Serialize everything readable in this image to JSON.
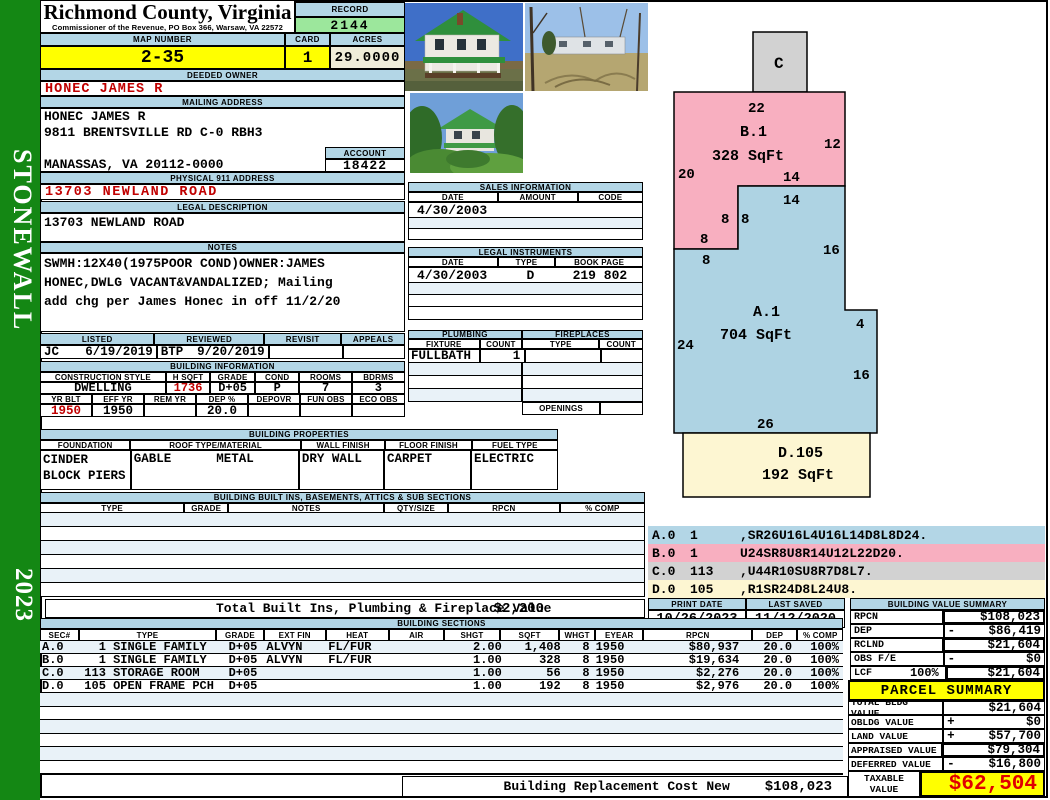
{
  "sidebar": {
    "district": "STONEWALL",
    "year": "2023"
  },
  "header": {
    "county": "Richmond County, Virginia",
    "commissioner": "Commissioner of the Revenue, PO Box 366, Warsaw, VA 22572",
    "record_label": "RECORD",
    "record_value": "2144",
    "map_label": "MAP NUMBER",
    "map_value": "2-35",
    "card_label": "CARD",
    "card_value": "1",
    "acres_label": "ACRES",
    "acres_value": "29.0000"
  },
  "owner": {
    "deeded_label": "DEEDED OWNER",
    "deeded": "HONEC JAMES R",
    "mailing_label": "MAILING ADDRESS",
    "mailing_line1": "HONEC JAMES R",
    "mailing_line2": "9811 BRENTSVILLE RD C-0 RBH3",
    "mailing_line3": "MANASSAS, VA 20112-0000",
    "account_label": "ACCOUNT",
    "account": "18422",
    "physical_label": "PHYSICAL 911 ADDRESS",
    "physical": "13703 NEWLAND ROAD",
    "legal_label": "LEGAL DESCRIPTION",
    "legal": "13703 NEWLAND ROAD"
  },
  "notes": {
    "label": "NOTES",
    "line1": "SWMH:12X40(1975POOR COND)OWNER:JAMES",
    "line2": "HONEC,DWLG VACANT&VANDALIZED; Mailing",
    "line3": "add chg per James Honec in off 11/2/20"
  },
  "review": {
    "listed_label": "LISTED",
    "reviewed_label": "REVIEWED",
    "revisit_label": "REVISIT",
    "appeals_label": "APPEALS",
    "listed_by": "JC",
    "listed_date": "6/19/2019",
    "reviewed_by": "BTP",
    "reviewed_date": "9/20/2019",
    "revisit": "",
    "appeals": ""
  },
  "building_info": {
    "label": "BUILDING INFORMATION",
    "h1": [
      "CONSTRUCTION STYLE",
      "H SQFT",
      "GRADE",
      "COND",
      "ROOMS",
      "BDRMS"
    ],
    "style": "DWELLING",
    "hsqft": "1736",
    "grade": "D+05",
    "cond": "P",
    "rooms": "7",
    "bdrms": "3",
    "h2": [
      "YR BLT",
      "EFF YR",
      "REM YR",
      "DEP %",
      "DEPOVR",
      "FUN OBS",
      "ECO OBS"
    ],
    "yr_blt": "1950",
    "eff_yr": "1950",
    "rem_yr": "",
    "dep_pct": "20.0",
    "depovr": "",
    "fun_obs": "",
    "eco_obs": ""
  },
  "properties": {
    "label": "BUILDING PROPERTIES",
    "headers": [
      "FOUNDATION",
      "ROOF TYPE/MATERIAL",
      "WALL FINISH",
      "FLOOR FINISH",
      "FUEL TYPE"
    ],
    "foundation": "CINDER BLOCK PIERS",
    "roof_type": "GABLE",
    "roof_material": "METAL",
    "wall_finish": "DRY WALL",
    "floor_finish": "CARPET",
    "fuel_type": "ELECTRIC"
  },
  "built_ins": {
    "label": "BUILDING BUILT INS, BASEMENTS, ATTICS & SUB SECTIONS",
    "headers": [
      "TYPE",
      "GRADE",
      "NOTES",
      "QTY/SIZE",
      "RPCN",
      "% COMP"
    ],
    "total_label": "Total Built Ins, Plumbing & Fireplace Value",
    "total_value": "$2,200"
  },
  "sales": {
    "label": "SALES INFORMATION",
    "headers": [
      "DATE",
      "AMOUNT",
      "CODE"
    ],
    "rows": [
      {
        "date": "4/30/2003",
        "amount": "",
        "code": ""
      }
    ]
  },
  "instruments": {
    "label": "LEGAL INSTRUMENTS",
    "headers": [
      "DATE",
      "TYPE",
      "BOOK PAGE"
    ],
    "rows": [
      {
        "date": "4/30/2003",
        "type": "D",
        "book_page": "219 802"
      }
    ]
  },
  "plumbing": {
    "label": "PLUMBING",
    "headers": [
      "FIXTURE",
      "COUNT"
    ],
    "rows": [
      {
        "fixture": "FULLBATH",
        "count": "1"
      }
    ]
  },
  "fireplaces": {
    "label": "FIREPLACES",
    "headers": [
      "TYPE",
      "COUNT"
    ],
    "openings_label": "OPENINGS"
  },
  "diagram": {
    "c_label": "C",
    "b_label": "B.1",
    "b_sqft": "328 SqFt",
    "a_label": "A.1",
    "a_sqft": "704 SqFt",
    "d_label": "D.105",
    "d_sqft": "192 SqFt",
    "dims": {
      "b_top": "22",
      "b_right": "12",
      "b_left": "20",
      "b_inner14": "14",
      "a_top14": "14",
      "step8a": "8",
      "step8b": "8",
      "step8c": "8",
      "step8d": "8",
      "a_right16u": "16",
      "a_left24": "24",
      "a_notch4": "4",
      "a_right16l": "16",
      "a_bottom26": "26"
    }
  },
  "vectors": [
    {
      "sec": "A.0",
      "qty": "1",
      "path": ",SR26U16L4U16L14D8L8D24."
    },
    {
      "sec": "B.0",
      "qty": "1",
      "path": "U24SR8U8R14U12L22D20."
    },
    {
      "sec": "C.0",
      "qty": "113",
      "path": ",U44R10SU8R7D8L7."
    },
    {
      "sec": "D.0",
      "qty": "105",
      "path": ",R1SR24D8L24U8."
    }
  ],
  "print_info": {
    "print_label": "PRINT DATE",
    "print_date": "10/26/2023",
    "saved_label": "LAST SAVED",
    "last_saved": "11/12/2020"
  },
  "value_summary": {
    "label": "BUILDING VALUE SUMMARY",
    "rows": [
      {
        "label": "RPCN",
        "mid": "",
        "op": "",
        "value": "$108,023"
      },
      {
        "label": "DEP",
        "mid": "",
        "op": "-",
        "value": "$86,419"
      },
      {
        "label": "RCLND",
        "mid": "",
        "op": "",
        "value": "$21,604"
      },
      {
        "label": "OBS F/E",
        "mid": "",
        "op": "-",
        "value": "$0"
      },
      {
        "label": "LCF",
        "mid": "100%",
        "op": "",
        "value": "$21,604"
      }
    ]
  },
  "building_sections": {
    "label": "BUILDING SECTIONS",
    "headers": [
      "SEC#",
      "TYPE",
      "GRADE",
      "EXT FIN",
      "HEAT",
      "AIR",
      "SHGT",
      "SQFT",
      "WHGT",
      "EYEAR",
      "RPCN",
      "DEP",
      "% COMP"
    ],
    "rows": [
      {
        "sec": "A.0",
        "type_code": "1",
        "type_name": "SINGLE FAMILY",
        "grade": "D+05",
        "ext_fin": "ALVYN",
        "heat": "FL/FUR",
        "air": "",
        "shgt": "2.00",
        "sqft": "1,408",
        "whgt": "8",
        "eyear": "1950",
        "rpcn": "$80,937",
        "dep": "20.0",
        "comp": "100%"
      },
      {
        "sec": "B.0",
        "type_code": "1",
        "type_name": "SINGLE FAMILY",
        "grade": "D+05",
        "ext_fin": "ALVYN",
        "heat": "FL/FUR",
        "air": "",
        "shgt": "1.00",
        "sqft": "328",
        "whgt": "8",
        "eyear": "1950",
        "rpcn": "$19,634",
        "dep": "20.0",
        "comp": "100%"
      },
      {
        "sec": "C.0",
        "type_code": "113",
        "type_name": "STORAGE ROOM",
        "grade": "D+05",
        "ext_fin": "",
        "heat": "",
        "air": "",
        "shgt": "1.00",
        "sqft": "56",
        "whgt": "8",
        "eyear": "1950",
        "rpcn": "$2,276",
        "dep": "20.0",
        "comp": "100%"
      },
      {
        "sec": "D.0",
        "type_code": "105",
        "type_name": "OPEN FRAME PCH",
        "grade": "D+05",
        "ext_fin": "",
        "heat": "",
        "air": "",
        "shgt": "1.00",
        "sqft": "192",
        "whgt": "8",
        "eyear": "1950",
        "rpcn": "$2,976",
        "dep": "20.0",
        "comp": "100%"
      }
    ]
  },
  "replacement": {
    "label": "Building Replacement Cost New",
    "value": "$108,023"
  },
  "parcel_summary": {
    "label": "PARCEL SUMMARY",
    "rows": [
      {
        "label": "TOTAL BLDG VALUE",
        "op": "",
        "value": "$21,604"
      },
      {
        "label": "OBLDG VALUE",
        "op": "+",
        "value": "$0"
      },
      {
        "label": "LAND VALUE",
        "op": "+",
        "value": "$57,700"
      },
      {
        "label": "APPRAISED VALUE",
        "op": "",
        "value": "$79,304"
      },
      {
        "label": "DEFERRED VALUE",
        "op": "-",
        "value": "$16,800"
      }
    ],
    "taxable_label": "TAXABLE VALUE",
    "taxable_value": "$62,504"
  },
  "colors": {
    "header_blue": "#b3d6e6",
    "highlight_yellow": "#ffff00",
    "record_green": "#9ce79c",
    "acres_beige": "#efecd9",
    "section_pink": "#f8afc0",
    "section_blue": "#aed3e3",
    "section_gray": "#d2d2d2",
    "section_cream": "#fdf6d2",
    "sidebar_green": "#148714",
    "alert_red": "#c00000",
    "taxable_red": "#e00000"
  }
}
